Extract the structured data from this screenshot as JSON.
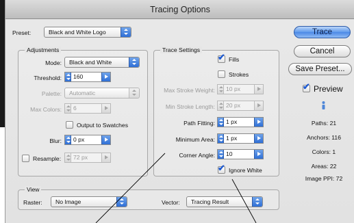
{
  "window": {
    "title": "Tracing Options"
  },
  "preset": {
    "label": "Preset:",
    "value": "Black and White Logo"
  },
  "adjustments": {
    "title": "Adjustments",
    "mode": {
      "label": "Mode:",
      "value": "Black and White"
    },
    "threshold": {
      "label": "Threshold:",
      "value": "160"
    },
    "palette": {
      "label": "Palette:",
      "value": "Automatic"
    },
    "max_colors": {
      "label": "Max Colors:",
      "value": "6"
    },
    "output_to_swatches": {
      "label": "Output to Swatches",
      "checked": false
    },
    "blur": {
      "label": "Blur:",
      "value": "0 px"
    },
    "resample": {
      "label": "Resample:",
      "value": "72 px",
      "checked": false
    }
  },
  "trace_settings": {
    "title": "Trace Settings",
    "fills": {
      "label": "Fills",
      "checked": true
    },
    "strokes": {
      "label": "Strokes",
      "checked": false
    },
    "max_stroke_weight": {
      "label": "Max Stroke Weight:",
      "value": "10 px"
    },
    "min_stroke_length": {
      "label": "Min Stroke Length:",
      "value": "20 px"
    },
    "path_fitting": {
      "label": "Path Fitting:",
      "value": "1 px"
    },
    "minimum_area": {
      "label": "Minimum Area:",
      "value": "1 px"
    },
    "corner_angle": {
      "label": "Corner Angle:",
      "value": "10"
    },
    "ignore_white": {
      "label": "Ignore White",
      "checked": true
    }
  },
  "view": {
    "title": "View",
    "raster": {
      "label": "Raster:",
      "value": "No Image"
    },
    "vector": {
      "label": "Vector:",
      "value": "Tracing Result"
    }
  },
  "buttons": {
    "trace": "Trace",
    "cancel": "Cancel",
    "save_preset": "Save Preset..."
  },
  "preview": {
    "label": "Preview",
    "checked": true
  },
  "stats": {
    "paths": "Paths: 21",
    "anchors": "Anchors: 116",
    "colors": "Colors: 1",
    "areas": "Areas: 22",
    "image_ppi": "Image PPI: 72"
  },
  "theme": {
    "accent": "#3b7be0",
    "dialog_bg": "#e6e6e6"
  }
}
